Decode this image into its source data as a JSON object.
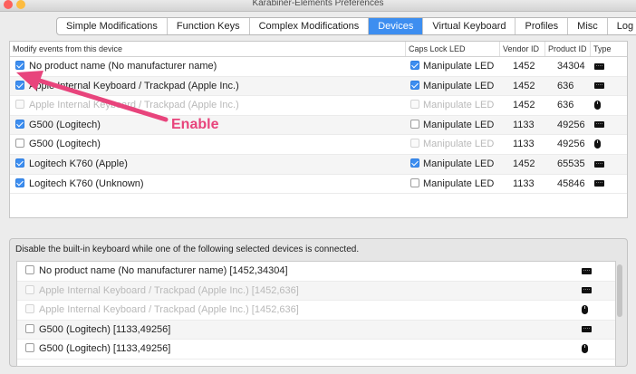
{
  "window": {
    "title": "Karabiner-Elements Preferences"
  },
  "colors": {
    "accent": "#3d8ef0",
    "annotation": "#e8447c"
  },
  "tabs": [
    {
      "label": "Simple Modifications",
      "active": false
    },
    {
      "label": "Function Keys",
      "active": false
    },
    {
      "label": "Complex Modifications",
      "active": false
    },
    {
      "label": "Devices",
      "active": true
    },
    {
      "label": "Virtual Keyboard",
      "active": false
    },
    {
      "label": "Profiles",
      "active": false
    },
    {
      "label": "Misc",
      "active": false
    },
    {
      "label": "Log",
      "active": false
    }
  ],
  "devices_table": {
    "headers": {
      "modify": "Modify events from this device",
      "caps": "Caps Lock LED",
      "vendor": "Vendor ID",
      "product": "Product ID",
      "type": "Type"
    },
    "rows": [
      {
        "name": "No product name (No manufacturer name)",
        "modify": true,
        "enabled": true,
        "led_label": "Manipulate LED",
        "led": true,
        "led_enabled": true,
        "vendor": "1452",
        "product": "34304",
        "type": "keyboard-icon"
      },
      {
        "name": "Apple Internal Keyboard / Trackpad (Apple Inc.)",
        "modify": true,
        "enabled": true,
        "led_label": "Manipulate LED",
        "led": true,
        "led_enabled": true,
        "vendor": "1452",
        "product": "636",
        "type": "keyboard-icon"
      },
      {
        "name": "Apple Internal Keyboard / Trackpad (Apple Inc.)",
        "modify": false,
        "enabled": false,
        "led_label": "Manipulate LED",
        "led": false,
        "led_enabled": false,
        "vendor": "1452",
        "product": "636",
        "type": "mouse-icon"
      },
      {
        "name": "G500 (Logitech)",
        "modify": true,
        "enabled": true,
        "led_label": "Manipulate LED",
        "led": false,
        "led_enabled": true,
        "vendor": "1133",
        "product": "49256",
        "type": "keyboard-icon"
      },
      {
        "name": "G500 (Logitech)",
        "modify": false,
        "enabled": true,
        "led_label": "Manipulate LED",
        "led": false,
        "led_enabled": false,
        "vendor": "1133",
        "product": "49256",
        "type": "mouse-icon"
      },
      {
        "name": "Logitech K760 (Apple)",
        "modify": true,
        "enabled": true,
        "led_label": "Manipulate LED",
        "led": true,
        "led_enabled": true,
        "vendor": "1452",
        "product": "65535",
        "type": "keyboard-icon"
      },
      {
        "name": "Logitech K760 (Unknown)",
        "modify": true,
        "enabled": true,
        "led_label": "Manipulate LED",
        "led": false,
        "led_enabled": true,
        "vendor": "1133",
        "product": "45846",
        "type": "keyboard-icon"
      }
    ]
  },
  "disable_builtin": {
    "label": "Disable the built-in keyboard while one of the following selected devices is connected.",
    "rows": [
      {
        "name": "No product name (No manufacturer name) [1452,34304]",
        "checked": false,
        "enabled": true,
        "type": "keyboard-icon"
      },
      {
        "name": "Apple Internal Keyboard / Trackpad (Apple Inc.) [1452,636]",
        "checked": false,
        "enabled": false,
        "type": "keyboard-icon"
      },
      {
        "name": "Apple Internal Keyboard / Trackpad (Apple Inc.) [1452,636]",
        "checked": false,
        "enabled": false,
        "type": "mouse-icon"
      },
      {
        "name": "G500 (Logitech) [1133,49256]",
        "checked": false,
        "enabled": true,
        "type": "keyboard-icon"
      },
      {
        "name": "G500 (Logitech) [1133,49256]",
        "checked": false,
        "enabled": true,
        "type": "mouse-icon"
      }
    ]
  },
  "annotation": {
    "label": "Enable"
  }
}
